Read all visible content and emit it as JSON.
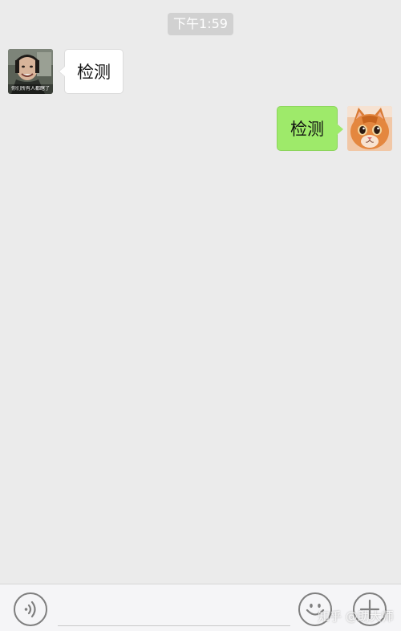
{
  "chat": {
    "timestamp": "下午1:59",
    "messages": [
      {
        "sender": "contact",
        "text": "检测",
        "avatar_caption": "你们所有人都瞎了"
      },
      {
        "sender": "me",
        "text": "检测"
      }
    ]
  },
  "input_bar": {
    "text_value": "",
    "voice_icon": "voice-icon",
    "emoji_icon": "emoji-icon",
    "plus_icon": "plus-icon"
  },
  "watermark": "知乎 @助大师",
  "colors": {
    "background": "#ebebeb",
    "incoming_bubble": "#ffffff",
    "outgoing_bubble": "#9eea6a",
    "time_pill": "#d1d1d1"
  }
}
